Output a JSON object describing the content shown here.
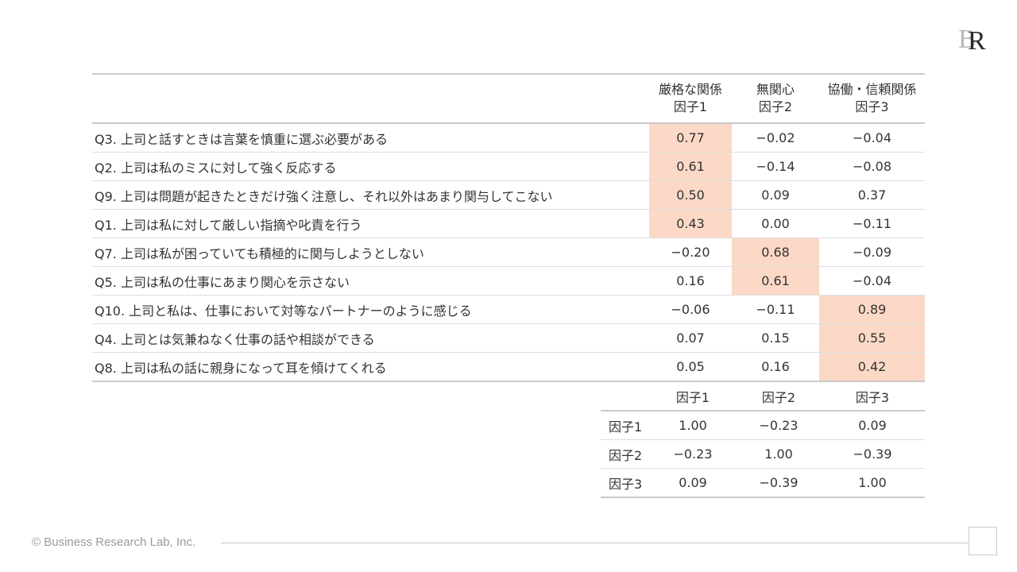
{
  "logo_text": "BR",
  "table": {
    "headers": [
      {
        "line1": "",
        "line2": ""
      },
      {
        "line1": "厳格な関係",
        "line2": "因子1"
      },
      {
        "line1": "無関心",
        "line2": "因子2"
      },
      {
        "line1": "協働・信頼関係",
        "line2": "因子3"
      }
    ],
    "rows": [
      {
        "item": "Q3. 上司と話すときは言葉を慎重に選ぶ必要がある",
        "values": [
          "0.77",
          "−0.02",
          "−0.04"
        ],
        "highlight": 0
      },
      {
        "item": "Q2. 上司は私のミスに対して強く反応する",
        "values": [
          "0.61",
          "−0.14",
          "−0.08"
        ],
        "highlight": 0
      },
      {
        "item": "Q9. 上司は問題が起きたときだけ強く注意し、それ以外はあまり関与してこない",
        "values": [
          "0.50",
          "0.09",
          "0.37"
        ],
        "highlight": 0
      },
      {
        "item": "Q1. 上司は私に対して厳しい指摘や叱責を行う",
        "values": [
          "0.43",
          "0.00",
          "−0.11"
        ],
        "highlight": 0
      },
      {
        "item": "Q7. 上司は私が困っていても積極的に関与しようとしない",
        "values": [
          "−0.20",
          "0.68",
          "−0.09"
        ],
        "highlight": 1
      },
      {
        "item": "Q5. 上司は私の仕事にあまり関心を示さない",
        "values": [
          "0.16",
          "0.61",
          "−0.04"
        ],
        "highlight": 1
      },
      {
        "item": "Q10. 上司と私は、仕事において対等なパートナーのように感じる",
        "values": [
          "−0.06",
          "−0.11",
          "0.89"
        ],
        "highlight": 2
      },
      {
        "item": "Q4. 上司とは気兼ねなく仕事の話や相談ができる",
        "values": [
          "0.07",
          "0.15",
          "0.55"
        ],
        "highlight": 2
      },
      {
        "item": "Q8. 上司は私の話に親身になって耳を傾けてくれる",
        "values": [
          "0.05",
          "0.16",
          "0.42"
        ],
        "highlight": 2
      }
    ]
  },
  "correlation": {
    "headers": [
      "",
      "因子1",
      "因子2",
      "因子3"
    ],
    "rows": [
      {
        "label": "因子1",
        "values": [
          "1.00",
          "−0.23",
          "0.09"
        ]
      },
      {
        "label": "因子2",
        "values": [
          "−0.23",
          "1.00",
          "−0.39"
        ]
      },
      {
        "label": "因子3",
        "values": [
          "0.09",
          "−0.39",
          "1.00"
        ]
      }
    ]
  },
  "colors": {
    "highlight": "#fbd9c6",
    "rule": "#c9c9c9"
  },
  "footer": {
    "copyright": "© Business Research Lab, Inc."
  }
}
